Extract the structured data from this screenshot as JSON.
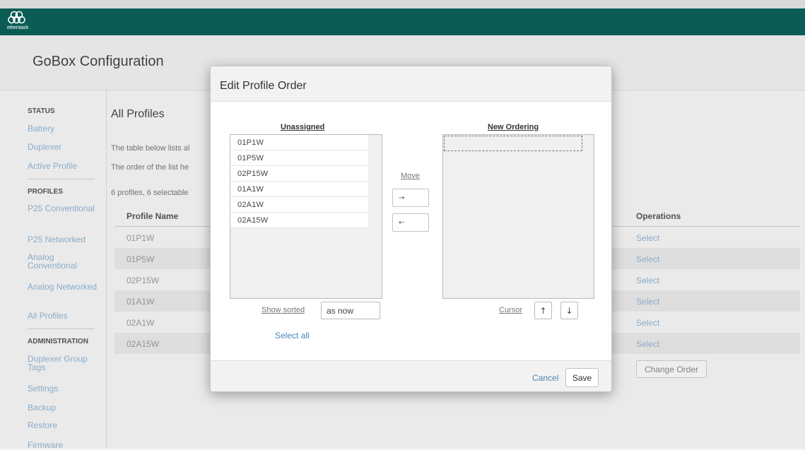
{
  "app": {
    "logo_text": "etherstack",
    "page_title": "GoBox Configuration"
  },
  "sidebar": {
    "status_head": "STATUS",
    "status_items": [
      "Battery",
      "Duplexer",
      "Active Profile"
    ],
    "profiles_head": "PROFILES",
    "profile_items": [
      "P25 Conventional",
      "P25 Networked",
      "Analog Conventional",
      "Analog Networked",
      "All Profiles"
    ],
    "admin_head": "ADMINISTRATION",
    "admin_items": [
      "Duplexer Group Tags",
      "Settings",
      "Backup",
      "Restore",
      "Firmware"
    ]
  },
  "main": {
    "title": "All Profiles",
    "desc1": "The table below lists al",
    "desc2": "The order of the list he",
    "count_text": "6 profiles, 6 selectable",
    "col_name": "Profile Name",
    "col_ops": "Operations",
    "rows": [
      {
        "name": "01P1W",
        "op": "Select"
      },
      {
        "name": "01P5W",
        "op": "Select"
      },
      {
        "name": "02P15W",
        "op": "Select"
      },
      {
        "name": "01A1W",
        "op": "Select"
      },
      {
        "name": "02A1W",
        "op": "Select"
      },
      {
        "name": "02A15W",
        "op": "Select"
      }
    ],
    "change_order": "Change Order"
  },
  "modal": {
    "title": "Edit Profile Order",
    "unassigned_title": "Unassigned",
    "new_ordering_title": "New Ordering",
    "unassigned_items": [
      "01P1W",
      "01P5W",
      "02P15W",
      "01A1W",
      "02A1W",
      "02A15W"
    ],
    "move_label": "Move",
    "move_right": "→",
    "move_left": "←",
    "show_sorted_label": "Show sorted",
    "sort_value": "as now",
    "select_all": "Select all",
    "cursor_label": "Cursor",
    "cursor_up": "↑",
    "cursor_down": "↓",
    "cancel": "Cancel",
    "save": "Save"
  },
  "colors": {
    "topbar": "#0b5c55",
    "link": "#4a86b8",
    "sidebar_link": "#8fb3d1"
  }
}
